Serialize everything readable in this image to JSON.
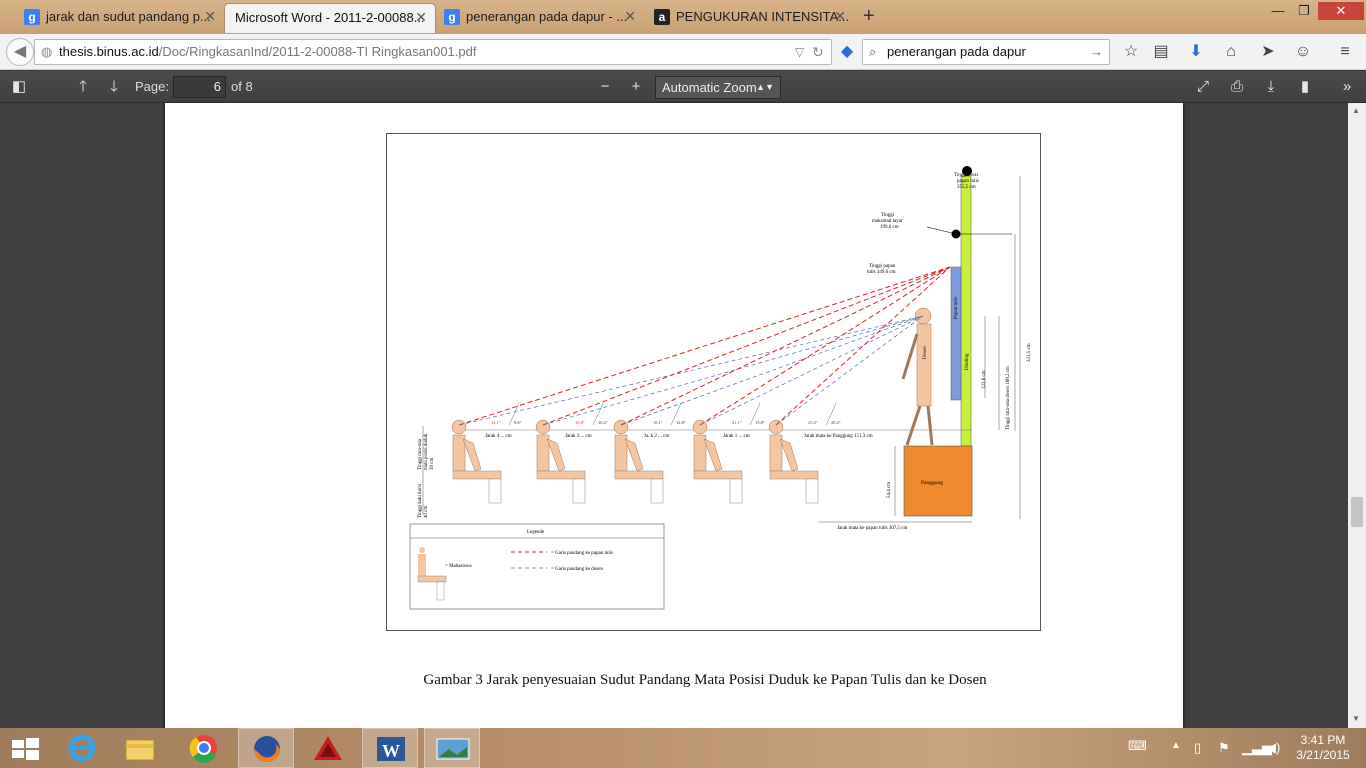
{
  "browser": {
    "tabs": [
      {
        "label": "jarak dan sudut pandang p...",
        "favicon": "google-g-icon",
        "active": false
      },
      {
        "label": "Microsoft Word - 2011-2-00088...",
        "favicon": "",
        "active": true
      },
      {
        "label": "penerangan pada dapur - ...",
        "favicon": "google-g-icon",
        "active": false
      },
      {
        "label": "PENGUKURAN INTENSITA...",
        "favicon": "academia-a-icon",
        "active": false
      }
    ],
    "url_host": "thesis.binus.ac.id",
    "url_path": "/Doc/RingkasanInd/2011-2-00088-TI Ringkasan001.pdf",
    "url_prefix": "",
    "search_query": "penerangan pada dapur"
  },
  "pdf_toolbar": {
    "page_label": "Page:",
    "page_number": "6",
    "page_of": "of 8",
    "zoom": "Automatic Zoom"
  },
  "figure": {
    "caption": "Gambar 3 Jarak penyesuaian Sudut Pandang Mata Posisi Duduk ke Papan Tulis dan ke Dosen",
    "labels": {
      "tinggi_awal": [
        "Tinggi awal",
        "papan tulis",
        "255,5 cm"
      ],
      "tinggi_maks": [
        "Tinggi",
        "maksimal layar",
        "199,6 cm"
      ],
      "tinggi_papan": [
        "Tinggi papan",
        "tulis 149,6 cm"
      ],
      "papan_tulis": "Papan tulis",
      "dinding": "Dinding",
      "dosen": "Dosen",
      "panggung": "Panggung",
      "dim_123": "123,6 cm",
      "dim_168": "Tinggi rata-rata dosen 168,2 cm",
      "dim_331": "331,5 cm",
      "dim_54": "54,4 cm",
      "jarak_panggung": "Jarak mata ke Panggung 151,3 cm",
      "jarak_papan": "Jarak mata ke papan tulis 307,5 cm",
      "tinggi_mata": [
        "Tinggi rata-rata",
        "mata posisi duduk",
        "39 cm"
      ],
      "tinggi_kaki": [
        "Tinggi kaki kursi",
        "40 cm"
      ],
      "jarak_labels": [
        "Jarak 4 ... cm",
        "Jarak 3 ... cm",
        "Ja..k 2 ... cm",
        "Jarak 1 ... cm"
      ],
      "angles_red": [
        "14,1°",
        "15,8°",
        "18,1°",
        "21,1°",
        "25,0°"
      ],
      "angles_blue": [
        "9,6°",
        "10,2°",
        "12,8°",
        "15,8°",
        "20,2°"
      ],
      "legend_title": "Legende",
      "legend_student": "= Mahasiswa",
      "legend_red": "= Garis pandang ke papan tulis",
      "legend_blue": "= Garis pandang ke dosen"
    }
  },
  "taskbar": {
    "time": "3:41 PM",
    "date": "3/21/2015"
  }
}
